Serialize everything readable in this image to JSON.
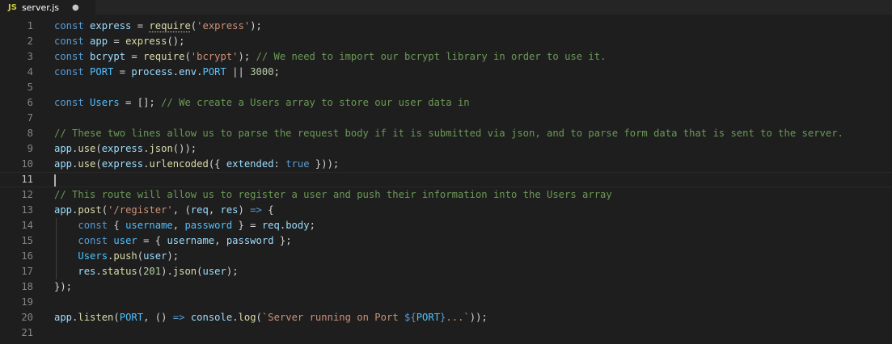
{
  "tab": {
    "icon": "JS",
    "filename": "server.js",
    "unsaved_dot": "●"
  },
  "editor": {
    "active_line": 11,
    "lines": [
      {
        "n": "1",
        "tokens": [
          [
            "kw",
            "const "
          ],
          [
            "var",
            "express"
          ],
          [
            "pun",
            " = "
          ],
          [
            "fn",
            "require"
          ],
          [
            "pun",
            "("
          ],
          [
            "str",
            "'express'"
          ],
          [
            "pun",
            ");"
          ]
        ]
      },
      {
        "n": "2",
        "tokens": [
          [
            "kw",
            "const "
          ],
          [
            "var",
            "app"
          ],
          [
            "pun",
            " = "
          ],
          [
            "fn",
            "express"
          ],
          [
            "pun",
            "();"
          ]
        ]
      },
      {
        "n": "3",
        "tokens": [
          [
            "kw",
            "const "
          ],
          [
            "var",
            "bcrypt"
          ],
          [
            "pun",
            " = "
          ],
          [
            "fn",
            "require"
          ],
          [
            "pun",
            "("
          ],
          [
            "str",
            "'bcrypt'"
          ],
          [
            "pun",
            "); "
          ],
          [
            "cmt",
            "// We need to import our bcrypt library in order to use it."
          ]
        ]
      },
      {
        "n": "4",
        "tokens": [
          [
            "kw",
            "const "
          ],
          [
            "cst",
            "PORT"
          ],
          [
            "pun",
            " = "
          ],
          [
            "var",
            "process"
          ],
          [
            "pun",
            "."
          ],
          [
            "var",
            "env"
          ],
          [
            "pun",
            "."
          ],
          [
            "cst",
            "PORT"
          ],
          [
            "pun",
            " || "
          ],
          [
            "num",
            "3000"
          ],
          [
            "pun",
            ";"
          ]
        ]
      },
      {
        "n": "5",
        "tokens": []
      },
      {
        "n": "6",
        "tokens": [
          [
            "kw",
            "const "
          ],
          [
            "cst",
            "Users"
          ],
          [
            "pun",
            " = []; "
          ],
          [
            "cmt",
            "// We create a Users array to store our user data in"
          ]
        ]
      },
      {
        "n": "7",
        "tokens": []
      },
      {
        "n": "8",
        "tokens": [
          [
            "cmt",
            "// These two lines allow us to parse the request body if it is submitted via json, and to parse form data that is sent to the server."
          ]
        ]
      },
      {
        "n": "9",
        "tokens": [
          [
            "var",
            "app"
          ],
          [
            "pun",
            "."
          ],
          [
            "fn",
            "use"
          ],
          [
            "pun",
            "("
          ],
          [
            "var",
            "express"
          ],
          [
            "pun",
            "."
          ],
          [
            "fn",
            "json"
          ],
          [
            "pun",
            "());"
          ]
        ]
      },
      {
        "n": "10",
        "tokens": [
          [
            "var",
            "app"
          ],
          [
            "pun",
            "."
          ],
          [
            "fn",
            "use"
          ],
          [
            "pun",
            "("
          ],
          [
            "var",
            "express"
          ],
          [
            "pun",
            "."
          ],
          [
            "fn",
            "urlencoded"
          ],
          [
            "pun",
            "({ "
          ],
          [
            "var",
            "extended"
          ],
          [
            "pun",
            ": "
          ],
          [
            "kw",
            "true"
          ],
          [
            "pun",
            " }));"
          ]
        ]
      },
      {
        "n": "11",
        "tokens": []
      },
      {
        "n": "12",
        "tokens": [
          [
            "cmt",
            "// This route will allow us to register a user and push their information into the Users array"
          ]
        ]
      },
      {
        "n": "13",
        "tokens": [
          [
            "var",
            "app"
          ],
          [
            "pun",
            "."
          ],
          [
            "fn",
            "post"
          ],
          [
            "pun",
            "("
          ],
          [
            "str",
            "'/register'"
          ],
          [
            "pun",
            ", ("
          ],
          [
            "var",
            "req"
          ],
          [
            "pun",
            ", "
          ],
          [
            "var",
            "res"
          ],
          [
            "pun",
            ") "
          ],
          [
            "kw",
            "=>"
          ],
          [
            "pun",
            " {"
          ]
        ]
      },
      {
        "n": "14",
        "tokens": [
          [
            "pun",
            "    "
          ],
          [
            "kw",
            "const"
          ],
          [
            "pun",
            " { "
          ],
          [
            "cst",
            "username"
          ],
          [
            "pun",
            ", "
          ],
          [
            "cst",
            "password"
          ],
          [
            "pun",
            " } = "
          ],
          [
            "var",
            "req"
          ],
          [
            "pun",
            "."
          ],
          [
            "var",
            "body"
          ],
          [
            "pun",
            ";"
          ]
        ]
      },
      {
        "n": "15",
        "tokens": [
          [
            "pun",
            "    "
          ],
          [
            "kw",
            "const "
          ],
          [
            "cst",
            "user"
          ],
          [
            "pun",
            " = { "
          ],
          [
            "var",
            "username"
          ],
          [
            "pun",
            ", "
          ],
          [
            "var",
            "password"
          ],
          [
            "pun",
            " };"
          ]
        ]
      },
      {
        "n": "16",
        "tokens": [
          [
            "pun",
            "    "
          ],
          [
            "cst",
            "Users"
          ],
          [
            "pun",
            "."
          ],
          [
            "fn",
            "push"
          ],
          [
            "pun",
            "("
          ],
          [
            "var",
            "user"
          ],
          [
            "pun",
            ");"
          ]
        ]
      },
      {
        "n": "17",
        "tokens": [
          [
            "pun",
            "    "
          ],
          [
            "var",
            "res"
          ],
          [
            "pun",
            "."
          ],
          [
            "fn",
            "status"
          ],
          [
            "pun",
            "("
          ],
          [
            "num",
            "201"
          ],
          [
            "pun",
            ")."
          ],
          [
            "fn",
            "json"
          ],
          [
            "pun",
            "("
          ],
          [
            "var",
            "user"
          ],
          [
            "pun",
            ");"
          ]
        ]
      },
      {
        "n": "18",
        "tokens": [
          [
            "pun",
            "});"
          ]
        ]
      },
      {
        "n": "19",
        "tokens": []
      },
      {
        "n": "20",
        "tokens": [
          [
            "var",
            "app"
          ],
          [
            "pun",
            "."
          ],
          [
            "fn",
            "listen"
          ],
          [
            "pun",
            "("
          ],
          [
            "cst",
            "PORT"
          ],
          [
            "pun",
            ", () "
          ],
          [
            "kw",
            "=>"
          ],
          [
            "pun",
            " "
          ],
          [
            "var",
            "console"
          ],
          [
            "pun",
            "."
          ],
          [
            "fn",
            "log"
          ],
          [
            "pun",
            "("
          ],
          [
            "str",
            "`Server running on Port "
          ],
          [
            "kw",
            "${"
          ],
          [
            "cst",
            "PORT"
          ],
          [
            "kw",
            "}"
          ],
          [
            "str",
            "...`"
          ],
          [
            "pun",
            "));"
          ]
        ]
      },
      {
        "n": "21",
        "tokens": []
      }
    ]
  }
}
